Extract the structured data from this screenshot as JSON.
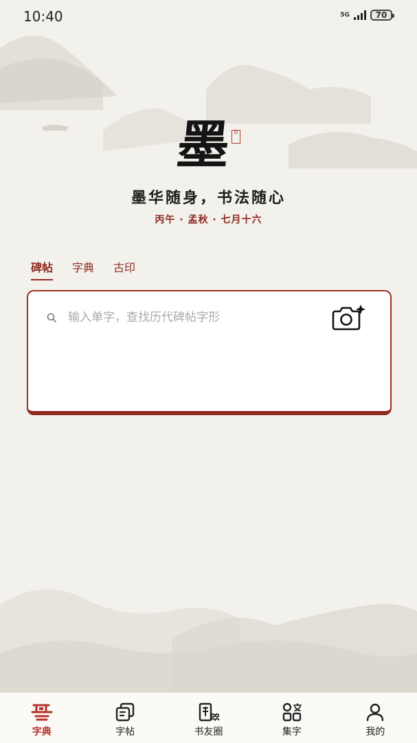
{
  "status_bar": {
    "time": "10:40",
    "network": "5G",
    "battery": "70"
  },
  "logo": {
    "char": "墨"
  },
  "slogan": "墨华随身，书法随心",
  "date_line": "丙午 · 孟秋 · 七月十六",
  "tabs": [
    {
      "label": "碑帖",
      "active": true
    },
    {
      "label": "字典",
      "active": false
    },
    {
      "label": "古印",
      "active": false
    }
  ],
  "search": {
    "placeholder": "输入单字，查找历代碑帖字形",
    "value": ""
  },
  "bottom_nav": [
    {
      "label": "字典",
      "icon": "dictionary-icon",
      "active": true
    },
    {
      "label": "字帖",
      "icon": "copybook-icon",
      "active": false
    },
    {
      "label": "书友圈",
      "icon": "community-icon",
      "active": false
    },
    {
      "label": "集字",
      "icon": "collect-chars-icon",
      "active": false
    },
    {
      "label": "我的",
      "icon": "profile-icon",
      "active": false
    }
  ],
  "colors": {
    "accent": "#8e2a21",
    "nav_active": "#b7322a",
    "background": "#f3f1ec"
  }
}
